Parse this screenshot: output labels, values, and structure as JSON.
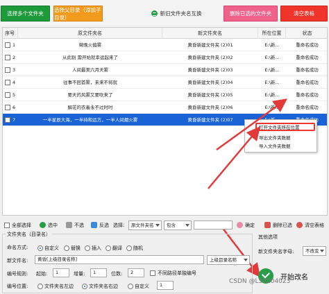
{
  "toolbar": {
    "select_folders": "选择多个文件夹",
    "select_parent": "选择父目录（添加子目录）",
    "swap_names": "新旧文件夹名互换",
    "delete_selected": "删除已选的文件夹",
    "clear_table": "清空表格"
  },
  "table": {
    "headers": [
      "序号",
      "原文件夹名",
      "新文件夹名",
      "所在位置",
      "状态"
    ],
    "rows": [
      {
        "idx": "1",
        "orig": "徵晚火偏雾",
        "new": "黄昏新建文件夹 (2)01",
        "loc": "E:\\新...",
        "status": "重命名成功"
      },
      {
        "idx": "2",
        "orig": "从此别 需开始就幸运起来了",
        "new": "黄昏新建文件夹 (2)02",
        "loc": "E:\\新...",
        "status": "重命名成功"
      },
      {
        "idx": "3",
        "orig": "人间最美六月天雾",
        "new": "黄昏新建文件夹 (2)03",
        "loc": "E:\\新...",
        "status": "重命名成功"
      },
      {
        "idx": "4",
        "orig": "往事不回首雾，未来不将就",
        "new": "黄昏新建文件夹 (2)04",
        "loc": "E:\\新...",
        "status": "重命名成功"
      },
      {
        "idx": "5",
        "orig": "要天的风雾又要吹来了",
        "new": "黄昏新建文件夹 (2)05",
        "loc": "E:\\新...",
        "status": "重命名成功"
      },
      {
        "idx": "6",
        "orig": "解花的衣着永不过时时",
        "new": "黄昏新建文件夹 (2)06",
        "loc": "E:\\新...",
        "status": "重命名成功"
      },
      {
        "idx": "7",
        "orig": "一半星辰大海，一半持和远方，一半人间烟火雾",
        "new": "黄昏新建文件夹 (2)07",
        "loc": "E:\\新...",
        "status": "重命名成功"
      }
    ]
  },
  "context_menu": {
    "open_location": "打开文件夹所在位置",
    "export": "导出文件夹数据",
    "import": "导入文件夹数据"
  },
  "filterbar": {
    "select_all": "全部选择",
    "select": "选中",
    "deselect": "不选",
    "invert": "反选",
    "choose_label": "选择:",
    "field_value": "原文件夹名",
    "match_value": "包含",
    "confirm": "确定",
    "delete_checked": "删除已选",
    "clear_table": "清空表格"
  },
  "rename_group": {
    "title": "文件夹名（目录名）",
    "mode_label": "命名方式:",
    "mode_options": [
      "自定义",
      "替换",
      "插入",
      "翻译",
      "随机"
    ],
    "new_name_label": "新文件名:",
    "new_name_value": "黄昏[上级目录名称]",
    "parent_dir_option": "上级目录名称",
    "numbering_label": "编号规则:",
    "start_label": "起始:",
    "start_value": "1",
    "increment_label": "增量:",
    "increment_value": "1",
    "digits_label": "位数:",
    "digits_value": "2",
    "no_pad_label": "不同路径单独编号",
    "position_label": "编号位置:",
    "position_options": [
      "文件夹名左边",
      "文件夹名右边",
      "自定义"
    ],
    "custom_value": "1"
  },
  "other": {
    "title": "其他选项",
    "case_label": "新文件夹名字母:",
    "case_value": "不改变"
  },
  "start_button": "开始改名",
  "watermark": "CSDN @L50204023",
  "colors": {
    "selected_row": "#1a63d6",
    "arrow": "#e23a3a"
  }
}
